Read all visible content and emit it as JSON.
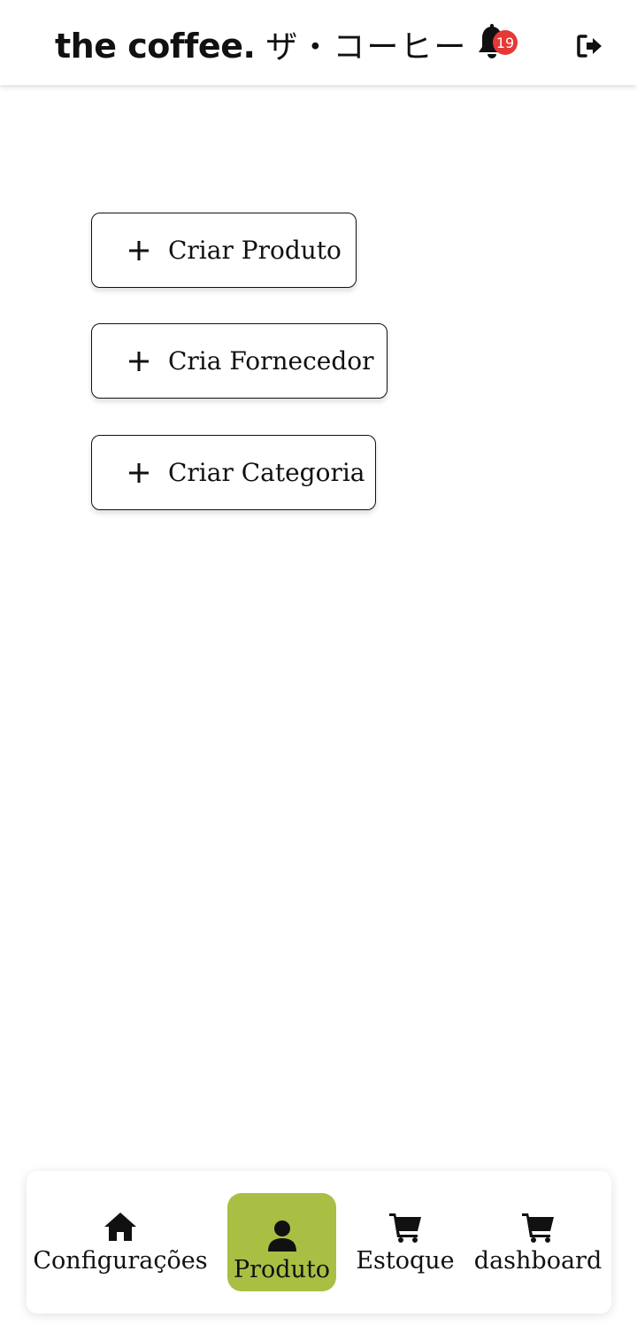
{
  "header": {
    "brand_name": "the coffee.",
    "brand_jp": "ザ・コーヒー",
    "notification_count": "19",
    "icons": {
      "bell": "bell-icon",
      "logout": "logout-icon"
    }
  },
  "actions": [
    {
      "label": "Criar Produto",
      "icon": "plus-icon"
    },
    {
      "label": "Cria Fornecedor",
      "icon": "plus-icon"
    },
    {
      "label": "Criar Categoria",
      "icon": "plus-icon"
    }
  ],
  "nav": {
    "active": "Produto",
    "active_color": "#a8bf44",
    "items": [
      {
        "label": "Configurações",
        "icon": "home-icon"
      },
      {
        "label": "Produto",
        "icon": "user-icon"
      },
      {
        "label": "Estoque",
        "icon": "cart-icon"
      },
      {
        "label": "dashboard",
        "icon": "cart-icon"
      }
    ]
  },
  "colors": {
    "badge": "#e53935",
    "accent": "#a8bf44"
  }
}
